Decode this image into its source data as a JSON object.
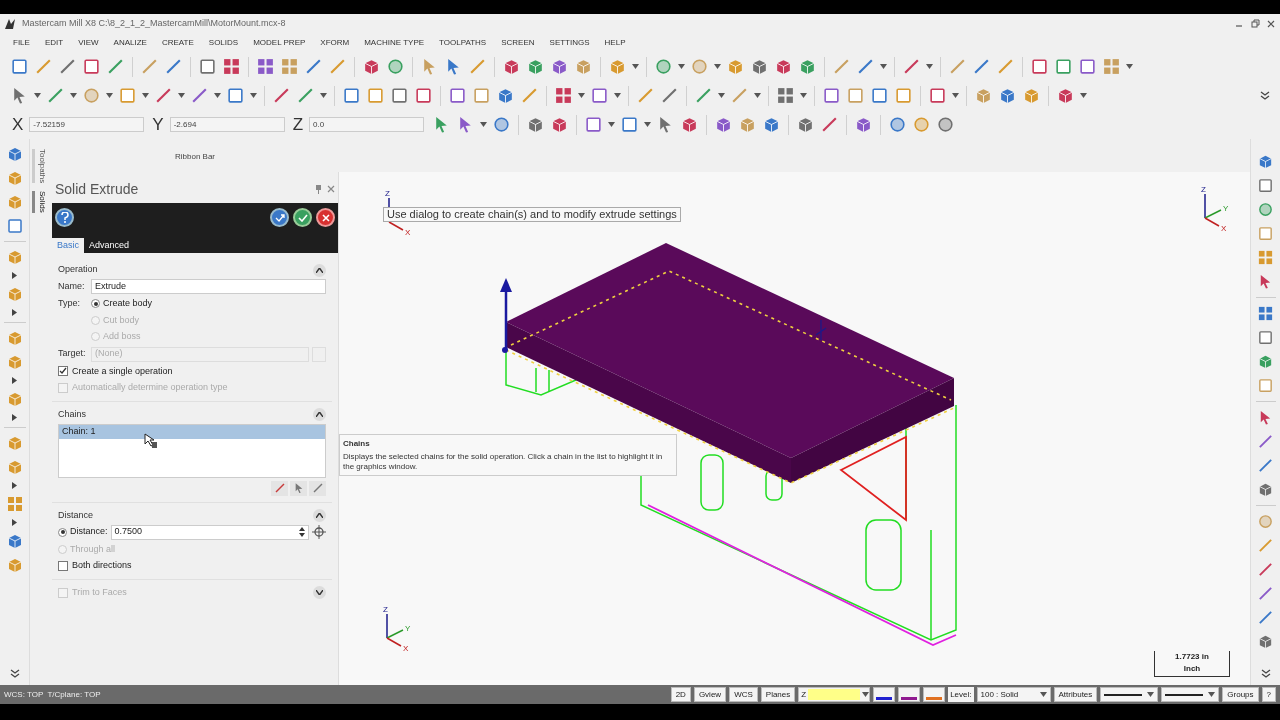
{
  "window": {
    "title": "Mastercam Mill X8  C:\\8_2_1_2_MastercamMill\\MotorMount.mcx-8"
  },
  "menu": [
    "FILE",
    "EDIT",
    "VIEW",
    "ANALIZE",
    "CREATE",
    "SOLIDS",
    "MODEL PREP",
    "XFORM",
    "MACHINE TYPE",
    "TOOLPATHS",
    "SCREEN",
    "SETTINGS",
    "HELP"
  ],
  "coordinates": [
    {
      "label": "X",
      "value": "-7.52159"
    },
    {
      "label": "Y",
      "value": "-2.694"
    },
    {
      "label": "Z",
      "value": "0.0"
    }
  ],
  "ribbon_label": "Ribbon Bar",
  "side_tabs": [
    {
      "label": "Toolpaths",
      "selected": false
    },
    {
      "label": "Solids",
      "selected": true
    }
  ],
  "panel": {
    "title": "Solid Extrude",
    "tabs": [
      {
        "label": "Basic",
        "selected": true
      },
      {
        "label": "Advanced",
        "selected": false
      }
    ],
    "sections": [
      {
        "kind": "operation",
        "title": "Operation",
        "expanded": true,
        "name_label": "Name:",
        "name_value": "Extrude",
        "type_label": "Type:",
        "types": [
          {
            "label": "Create body",
            "selected": true,
            "disabled": false
          },
          {
            "label": "Cut body",
            "selected": false,
            "disabled": true
          },
          {
            "label": "Add boss",
            "selected": false,
            "disabled": true
          }
        ],
        "target_label": "Target:",
        "target_value": "(None)",
        "options": [
          {
            "label": "Create a single operation",
            "checked": true,
            "disabled": false
          },
          {
            "label": "Automatically determine operation type",
            "checked": false,
            "disabled": true
          }
        ]
      },
      {
        "kind": "chains",
        "title": "Chains",
        "expanded": true,
        "items": [
          {
            "label": "Chain: 1",
            "selected": true
          }
        ]
      },
      {
        "kind": "distance",
        "title": "Distance",
        "expanded": true,
        "modes": [
          {
            "label": "Distance:",
            "selected": true,
            "disabled": false,
            "value": "0.7500"
          },
          {
            "label": "Through all",
            "selected": false,
            "disabled": true
          }
        ],
        "options": [
          {
            "label": "Both directions",
            "checked": false,
            "disabled": false
          }
        ]
      },
      {
        "kind": "trim",
        "title": "Trim to Faces",
        "expanded": false,
        "checked": false,
        "disabled": true
      }
    ]
  },
  "viewport": {
    "prompt": "Use dialog to create chain(s) and to modify extrude settings",
    "tooltip": {
      "title": "Chains",
      "text": "Displays the selected chains for the solid operation. Click a chain in the list to highlight it in the graphics window."
    },
    "scale": {
      "value": "1.7723 in",
      "unit": "Inch"
    },
    "triads": [
      {
        "z": "Z",
        "x": "X"
      },
      {
        "z": "Z",
        "y": "Y",
        "x": "X"
      },
      {
        "z": "Z",
        "y": "Y",
        "x": "X"
      }
    ]
  },
  "status_bar": {
    "text": "WCS: TOP  T/Cplane: TOP",
    "controls": [
      {
        "kind": "button",
        "label": "2D"
      },
      {
        "kind": "button",
        "label": "Gview"
      },
      {
        "kind": "button",
        "label": "WCS"
      },
      {
        "kind": "button",
        "label": "Planes"
      },
      {
        "kind": "zfield",
        "label": "Z"
      },
      {
        "kind": "swatch",
        "color": "#2020d0"
      },
      {
        "kind": "swatch",
        "color": "#901a90"
      },
      {
        "kind": "swatch",
        "color": "#e07020"
      },
      {
        "kind": "label",
        "label": "Level:"
      },
      {
        "kind": "select",
        "label": "100 : Solid"
      },
      {
        "kind": "button",
        "label": "Attributes"
      },
      {
        "kind": "linestyle"
      },
      {
        "kind": "linestyle"
      },
      {
        "kind": "button",
        "label": "Groups"
      },
      {
        "kind": "button",
        "label": "?"
      }
    ]
  }
}
